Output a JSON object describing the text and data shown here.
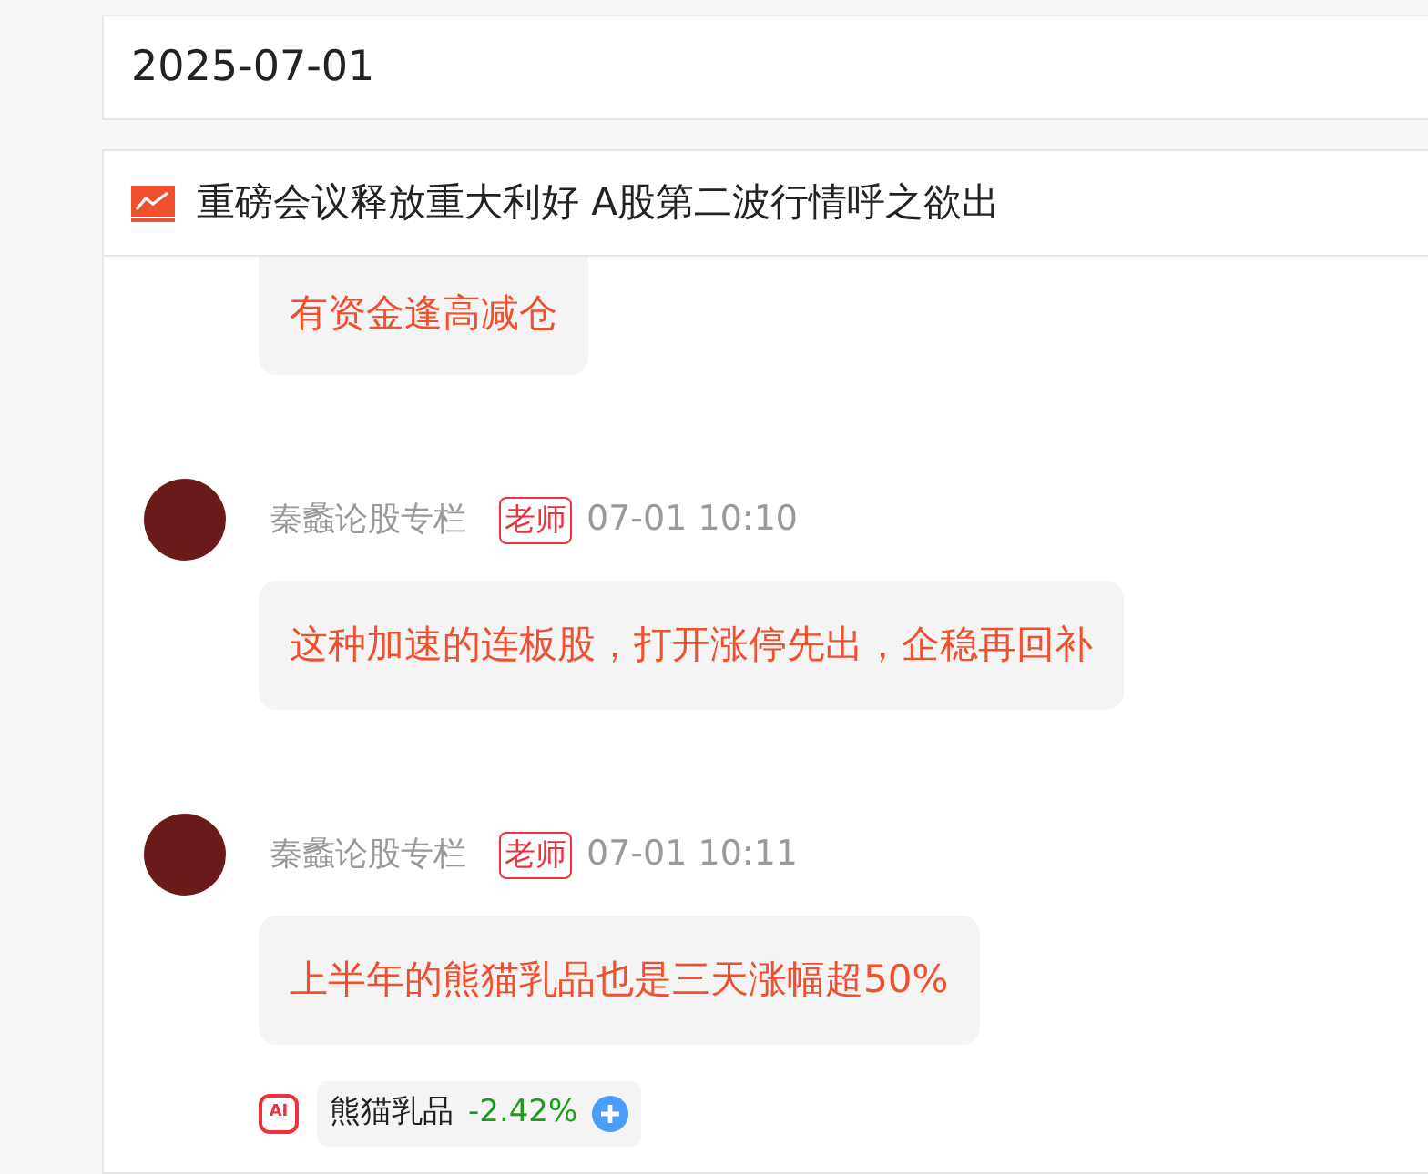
{
  "date": "2025-07-01",
  "article": {
    "title": "重磅会议释放重大利好 A股第二波行情呼之欲出"
  },
  "messages": [
    {
      "kind": "continuation",
      "text": "有资金逢高减仓"
    },
    {
      "kind": "full",
      "author": "秦蠡论股专栏",
      "role_badge": "老师",
      "time": "07-01 10:10",
      "text": "这种加速的连板股，打开涨停先出，企稳再回补"
    },
    {
      "kind": "full",
      "author": "秦蠡论股专栏",
      "role_badge": "老师",
      "time": "07-01 10:11",
      "text": "上半年的熊猫乳品也是三天涨幅超50%",
      "stock": {
        "ai_label": "AI",
        "name": "熊猫乳品",
        "change": "-2.42%",
        "color": "#1a9e1a"
      }
    }
  ]
}
